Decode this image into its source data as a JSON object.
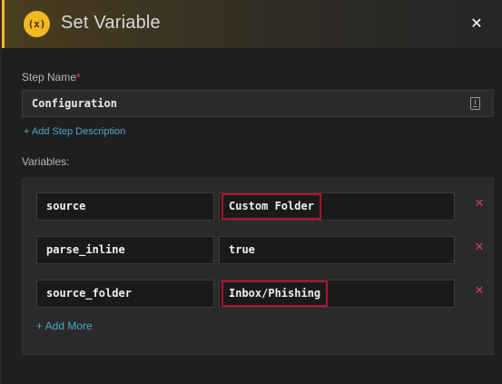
{
  "header": {
    "badge": "(x)",
    "title": "Set Variable",
    "close_glyph": "✕"
  },
  "form": {
    "step_name_label": "Step Name",
    "required_mark": "*",
    "step_name_value": "Configuration",
    "add_description_link": "+ Add Step Description",
    "variables_label": "Variables:"
  },
  "variables": [
    {
      "key": "source",
      "value": "Custom Folder",
      "highlighted": true
    },
    {
      "key": "parse_inline",
      "value": "true",
      "highlighted": false
    },
    {
      "key": "source_folder",
      "value": "Inbox/Phishing",
      "highlighted": true
    }
  ],
  "add_more_link": "+ Add More",
  "delete_glyph": "✕",
  "colors": {
    "accent": "#f5b820",
    "link": "#4aa8c9",
    "delete": "#d0444a",
    "highlight_border": "#b0132d"
  },
  "icons": {
    "header_badge": "variable-icon",
    "close": "close-icon",
    "step_input": "document-icon",
    "delete": "delete-icon"
  }
}
